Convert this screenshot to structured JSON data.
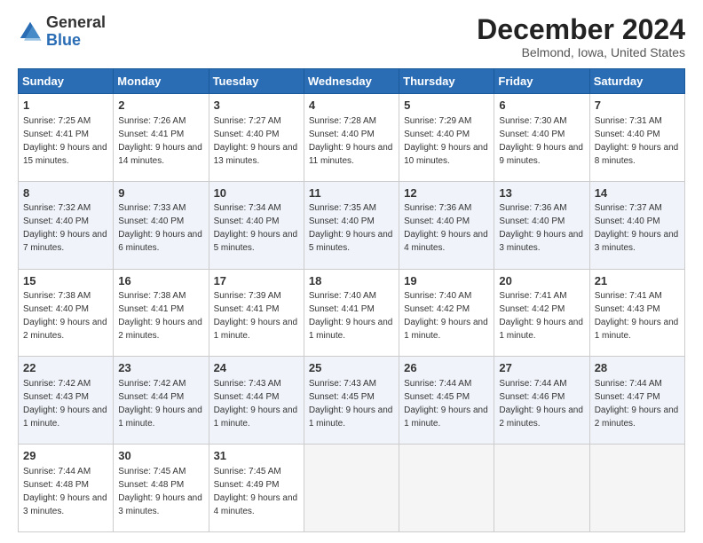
{
  "header": {
    "logo_general": "General",
    "logo_blue": "Blue",
    "title": "December 2024",
    "location": "Belmond, Iowa, United States"
  },
  "days_of_week": [
    "Sunday",
    "Monday",
    "Tuesday",
    "Wednesday",
    "Thursday",
    "Friday",
    "Saturday"
  ],
  "weeks": [
    [
      {
        "day": "1",
        "sunrise": "7:25 AM",
        "sunset": "4:41 PM",
        "daylight": "9 hours and 15 minutes."
      },
      {
        "day": "2",
        "sunrise": "7:26 AM",
        "sunset": "4:41 PM",
        "daylight": "9 hours and 14 minutes."
      },
      {
        "day": "3",
        "sunrise": "7:27 AM",
        "sunset": "4:40 PM",
        "daylight": "9 hours and 13 minutes."
      },
      {
        "day": "4",
        "sunrise": "7:28 AM",
        "sunset": "4:40 PM",
        "daylight": "9 hours and 11 minutes."
      },
      {
        "day": "5",
        "sunrise": "7:29 AM",
        "sunset": "4:40 PM",
        "daylight": "9 hours and 10 minutes."
      },
      {
        "day": "6",
        "sunrise": "7:30 AM",
        "sunset": "4:40 PM",
        "daylight": "9 hours and 9 minutes."
      },
      {
        "day": "7",
        "sunrise": "7:31 AM",
        "sunset": "4:40 PM",
        "daylight": "9 hours and 8 minutes."
      }
    ],
    [
      {
        "day": "8",
        "sunrise": "7:32 AM",
        "sunset": "4:40 PM",
        "daylight": "9 hours and 7 minutes."
      },
      {
        "day": "9",
        "sunrise": "7:33 AM",
        "sunset": "4:40 PM",
        "daylight": "9 hours and 6 minutes."
      },
      {
        "day": "10",
        "sunrise": "7:34 AM",
        "sunset": "4:40 PM",
        "daylight": "9 hours and 5 minutes."
      },
      {
        "day": "11",
        "sunrise": "7:35 AM",
        "sunset": "4:40 PM",
        "daylight": "9 hours and 5 minutes."
      },
      {
        "day": "12",
        "sunrise": "7:36 AM",
        "sunset": "4:40 PM",
        "daylight": "9 hours and 4 minutes."
      },
      {
        "day": "13",
        "sunrise": "7:36 AM",
        "sunset": "4:40 PM",
        "daylight": "9 hours and 3 minutes."
      },
      {
        "day": "14",
        "sunrise": "7:37 AM",
        "sunset": "4:40 PM",
        "daylight": "9 hours and 3 minutes."
      }
    ],
    [
      {
        "day": "15",
        "sunrise": "7:38 AM",
        "sunset": "4:40 PM",
        "daylight": "9 hours and 2 minutes."
      },
      {
        "day": "16",
        "sunrise": "7:38 AM",
        "sunset": "4:41 PM",
        "daylight": "9 hours and 2 minutes."
      },
      {
        "day": "17",
        "sunrise": "7:39 AM",
        "sunset": "4:41 PM",
        "daylight": "9 hours and 1 minute."
      },
      {
        "day": "18",
        "sunrise": "7:40 AM",
        "sunset": "4:41 PM",
        "daylight": "9 hours and 1 minute."
      },
      {
        "day": "19",
        "sunrise": "7:40 AM",
        "sunset": "4:42 PM",
        "daylight": "9 hours and 1 minute."
      },
      {
        "day": "20",
        "sunrise": "7:41 AM",
        "sunset": "4:42 PM",
        "daylight": "9 hours and 1 minute."
      },
      {
        "day": "21",
        "sunrise": "7:41 AM",
        "sunset": "4:43 PM",
        "daylight": "9 hours and 1 minute."
      }
    ],
    [
      {
        "day": "22",
        "sunrise": "7:42 AM",
        "sunset": "4:43 PM",
        "daylight": "9 hours and 1 minute."
      },
      {
        "day": "23",
        "sunrise": "7:42 AM",
        "sunset": "4:44 PM",
        "daylight": "9 hours and 1 minute."
      },
      {
        "day": "24",
        "sunrise": "7:43 AM",
        "sunset": "4:44 PM",
        "daylight": "9 hours and 1 minute."
      },
      {
        "day": "25",
        "sunrise": "7:43 AM",
        "sunset": "4:45 PM",
        "daylight": "9 hours and 1 minute."
      },
      {
        "day": "26",
        "sunrise": "7:44 AM",
        "sunset": "4:45 PM",
        "daylight": "9 hours and 1 minute."
      },
      {
        "day": "27",
        "sunrise": "7:44 AM",
        "sunset": "4:46 PM",
        "daylight": "9 hours and 2 minutes."
      },
      {
        "day": "28",
        "sunrise": "7:44 AM",
        "sunset": "4:47 PM",
        "daylight": "9 hours and 2 minutes."
      }
    ],
    [
      {
        "day": "29",
        "sunrise": "7:44 AM",
        "sunset": "4:48 PM",
        "daylight": "9 hours and 3 minutes."
      },
      {
        "day": "30",
        "sunrise": "7:45 AM",
        "sunset": "4:48 PM",
        "daylight": "9 hours and 3 minutes."
      },
      {
        "day": "31",
        "sunrise": "7:45 AM",
        "sunset": "4:49 PM",
        "daylight": "9 hours and 4 minutes."
      },
      null,
      null,
      null,
      null
    ]
  ]
}
